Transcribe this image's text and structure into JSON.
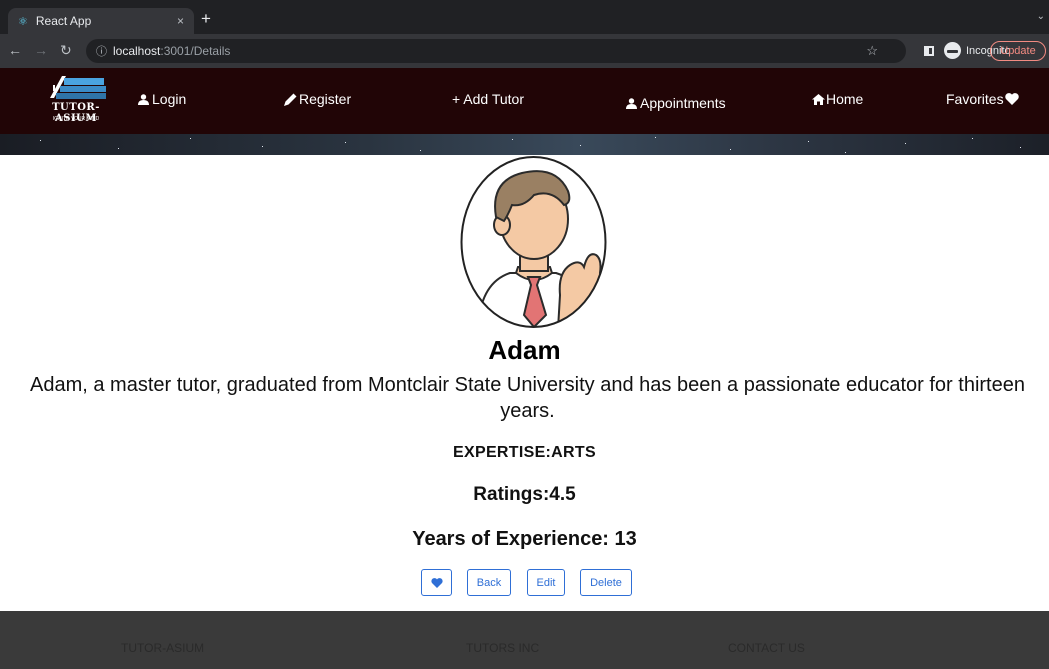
{
  "browser": {
    "tab_title": "React App",
    "tab_close": "×",
    "new_tab": "+",
    "url_host": "localhost",
    "url_path": ":3001/Details",
    "incognito_label": "Incognito",
    "update_label": "Update"
  },
  "site": {
    "logo_text": "TUTOR-ASIUM",
    "logo_tagline": "IGNITE YOUR MIND",
    "nav": {
      "login": "Login",
      "register": "Register",
      "add_tutor": "+ Add Tutor",
      "appointments": "Appointments",
      "home": "Home",
      "favorites": "Favorites"
    }
  },
  "tutor": {
    "name": "Adam",
    "bio": "Adam, a master tutor, graduated from Montclair State University and has been a passionate educator for thirteen years.",
    "expertise": "EXPERTISE:ARTS",
    "ratings": "Ratings:4.5",
    "years": "Years of Experience: 13"
  },
  "actions": {
    "back": "Back",
    "edit": "Edit",
    "delete": "Delete"
  },
  "footer": {
    "col1": "TUTOR-ASIUM",
    "col2": "TUTORS INC",
    "col3": "CONTACT US"
  },
  "colors": {
    "nav_bg": "#210506",
    "button_accent": "#2f6fd6",
    "footer_bg": "#3a3a3a"
  }
}
